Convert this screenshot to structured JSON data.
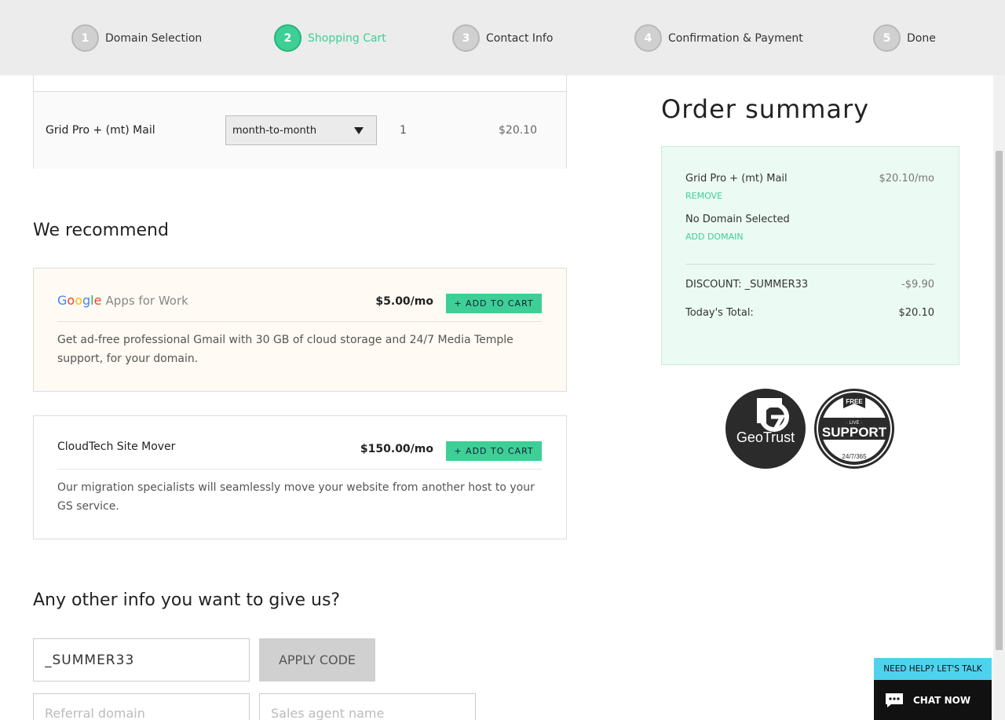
{
  "steps": [
    {
      "num": "1",
      "label": "Domain Selection"
    },
    {
      "num": "2",
      "label": "Shopping Cart"
    },
    {
      "num": "3",
      "label": "Contact Info"
    },
    {
      "num": "4",
      "label": "Confirmation & Payment"
    },
    {
      "num": "5",
      "label": "Done"
    }
  ],
  "active_step": 2,
  "cart": {
    "item_name": "Grid Pro + (mt) Mail",
    "term": "month-to-month",
    "quantity": "1",
    "price": "$20.10"
  },
  "recommend": {
    "title": "We recommend",
    "items": [
      {
        "brand": "Google",
        "name": "Apps for Work",
        "price": "$5.00/mo",
        "button": "+ ADD TO CART",
        "description": "Get ad-free professional Gmail with 30 GB of cloud storage and 24/7 Media Temple support, for your domain."
      },
      {
        "name": "CloudTech Site Mover",
        "price": "$150.00/mo",
        "button": "+ ADD TO CART",
        "description": "Our migration specialists will seamlessly move your website from another host to your GS service."
      }
    ]
  },
  "other_info": {
    "title": "Any other info you want to give us?",
    "promo_code_value": "_SUMMER33",
    "apply_button": "APPLY CODE",
    "referral_placeholder": "Referral domain",
    "sales_agent_placeholder": "Sales agent name"
  },
  "summary": {
    "title": "Order summary",
    "item_name": "Grid Pro + (mt) Mail",
    "item_price": "$20.10/mo",
    "remove_link": "REMOVE",
    "no_domain": "No Domain Selected",
    "add_domain_link": "ADD DOMAIN",
    "discount_label": "DISCOUNT: _SUMMER33",
    "discount_value": "-$9.90",
    "total_label": "Today's Total:",
    "total_value": "$20.10"
  },
  "badges": {
    "geotrust": "GeoTrust",
    "support_top": "FREE",
    "support_live": "· LIVE ·",
    "support_main": "SUPPORT",
    "support_hours": "24/7/365"
  },
  "chat": {
    "help_text": "NEED HELP? LET'S TALK",
    "chat_label": "CHAT NOW"
  },
  "colors": {
    "accent_green": "#3ecf96",
    "chat_cyan": "#4fd2ed"
  }
}
